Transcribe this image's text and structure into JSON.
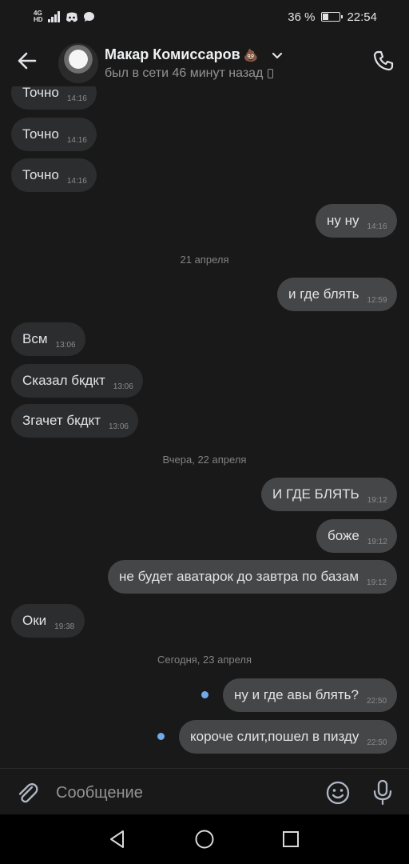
{
  "status_bar": {
    "network_top": "4G",
    "network_bottom": "HD",
    "battery_percent": "36 %",
    "battery_level": 0.36,
    "time": "22:54"
  },
  "header": {
    "name": "Макар Комиссаров",
    "name_emoji": "💩",
    "last_seen": "был в сети 46 минут назад",
    "icons": [
      "arrow-left-icon",
      "chevron-down-icon",
      "phone-icon"
    ]
  },
  "messages": [
    {
      "dir": "in",
      "text": "Точно",
      "time": "14:16"
    },
    {
      "dir": "in",
      "text": "Точно",
      "time": "14:16"
    },
    {
      "dir": "in",
      "text": "Точно",
      "time": "14:16"
    },
    {
      "dir": "out",
      "text": "ну ну",
      "time": "14:16"
    },
    {
      "type": "date",
      "text": "21 апреля"
    },
    {
      "dir": "out",
      "text": "и где блять",
      "time": "12:59"
    },
    {
      "dir": "in",
      "text": "Всм",
      "time": "13:06"
    },
    {
      "dir": "in",
      "text": "Сказал бкдкт",
      "time": "13:06"
    },
    {
      "dir": "in",
      "text": "Згачет бкдкт",
      "time": "13:06"
    },
    {
      "type": "date",
      "text": "Вчера, 22 апреля"
    },
    {
      "dir": "out",
      "text": "И ГДЕ БЛЯТЬ",
      "time": "19:12"
    },
    {
      "dir": "out",
      "text": "боже",
      "time": "19:12"
    },
    {
      "dir": "out",
      "text": "не будет аватарок до завтра по базам",
      "time": "19:12"
    },
    {
      "dir": "in",
      "text": "Оки",
      "time": "19:38"
    },
    {
      "type": "date",
      "text": "Сегодня, 23 апреля"
    },
    {
      "dir": "out",
      "text": "ну и где авы блять?",
      "time": "22:50",
      "unread": true
    },
    {
      "dir": "out",
      "text": "короче слит,пошел в пизду",
      "time": "22:50",
      "unread": true
    }
  ],
  "composer": {
    "placeholder": "Сообщение",
    "icons": [
      "paperclip-icon",
      "smile-icon",
      "microphone-icon"
    ]
  },
  "colors": {
    "background": "#191919",
    "incoming_bubble": "#2c2d2e",
    "outgoing_bubble": "#454647",
    "unread_dot": "#71aaeb"
  }
}
